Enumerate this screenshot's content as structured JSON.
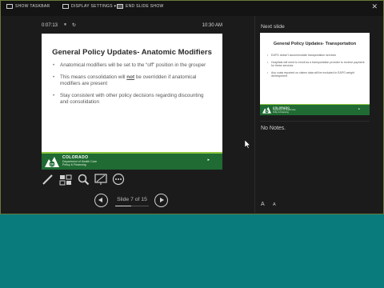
{
  "topbar": {
    "show_taskbar": "SHOW TASKBAR",
    "display_settings": "DISPLAY SETTINGS ▾",
    "end_show": "END SLIDE SHOW",
    "close": "✕"
  },
  "timer": {
    "elapsed": "0:07:13",
    "pause_icon": "⏸",
    "reset_icon": "↻",
    "clock": "10:30 AM"
  },
  "current_slide": {
    "title": "General Policy Updates- Anatomic Modifiers",
    "bullet1": "Anatomical modifiers will be set to the “off” position in the grouper",
    "bullet2_pre": "This means consolidation will ",
    "bullet2_emph": "not",
    "bullet2_post": " be overridden if anatomical modifiers are present",
    "bullet3": "Stay consistent with other policy decisions regarding discounting and consolidation",
    "footer": {
      "org": "COLORADO",
      "dept_line1": "Department of Health Care",
      "dept_line2": "Policy & Financing",
      "logo_text": "CO",
      "arrow": "▸"
    }
  },
  "navigation": {
    "slide_counter": "Slide 7 of 15",
    "progress": 0.47
  },
  "next_slide": {
    "label": "Next slide",
    "title": "General Policy Updates- Transportation",
    "bullet1": "EAPG doesn't accommodate transportation services",
    "bullet2": "Hospitals will need to enroll as a transportation provider to receive payment for these services",
    "bullet3": "Any costs reported on claims data will be excluded in EAPG weight development",
    "footer": {
      "org": "COLORADO",
      "dept_line1": "Department of Health Care",
      "dept_line2": "Policy & Financing",
      "logo_text": "CO",
      "arrow": "▸"
    }
  },
  "notes": {
    "text": "No Notes."
  },
  "font_controls": {
    "increase": "A",
    "decrease": "A"
  },
  "colors": {
    "presenter_bg": "#1b1b1b",
    "desktop_bg": "#0a7b7c",
    "footer_green": "#1f6b33",
    "accent_green": "#8dc63f"
  }
}
